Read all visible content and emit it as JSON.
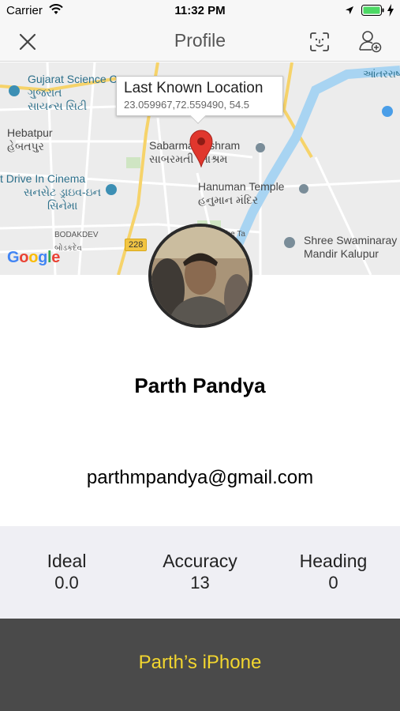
{
  "status_bar": {
    "carrier": "Carrier",
    "time": "11:32 PM",
    "icons": [
      "wifi-icon",
      "location-arrow-icon",
      "battery-icon",
      "charging-bolt-icon"
    ]
  },
  "nav": {
    "title": "Profile",
    "left_icon": "close-icon",
    "right_icons": [
      "face-scan-icon",
      "add-user-icon"
    ]
  },
  "map": {
    "callout_title": "Last Known Location",
    "callout_subtitle": "23.059967,72.559490, 54.5",
    "labels": {
      "gujarat_science_en": "Gujarat Science C",
      "gujarat_science_gu1": "ગુજરાત",
      "gujarat_science_gu2": "સાયન્સ સિટી",
      "hebatpur_en": "Hebatpur",
      "hebatpur_gu": "હેબતપુર",
      "sabarmati_en": "Sabarmati Ashram",
      "sabarmati_gu": "સાબરમતી આશ્રમ",
      "drive_in_en": "t Drive In Cinema",
      "drive_in_gu1": "સનસેટ ડ્રાઇવ-ઇન",
      "drive_in_gu2": "સિનેમા",
      "hanuman_en": "Hanuman Temple",
      "hanuman_gu": "હનુમાન મંદિર",
      "bodakdev_en": "BODAKDEV",
      "bodakdev_gu": "બોડકદેવ",
      "hobbit": "Hobbit The Ta",
      "shree_en1": "Shree Swaminaray",
      "shree_en2": "Mandir Kalupur",
      "airport_gu": "આંતરરાષ્ટ્ર",
      "road_number": "228",
      "google": "Google"
    },
    "colors": {
      "river": "#a8d4f2",
      "road_major": "#f6d36a",
      "land": "#ececec",
      "pin": "#e0372d"
    }
  },
  "profile": {
    "name": "Parth Pandya",
    "email": "parthmpandya@gmail.com"
  },
  "stats": [
    {
      "label": "Ideal",
      "value": "0.0"
    },
    {
      "label": "Accuracy",
      "value": "13"
    },
    {
      "label": "Heading",
      "value": "0"
    }
  ],
  "footer": {
    "device_name": "Parth’s iPhone",
    "text_color": "#f2d62f",
    "background": "#4a4a4a"
  }
}
